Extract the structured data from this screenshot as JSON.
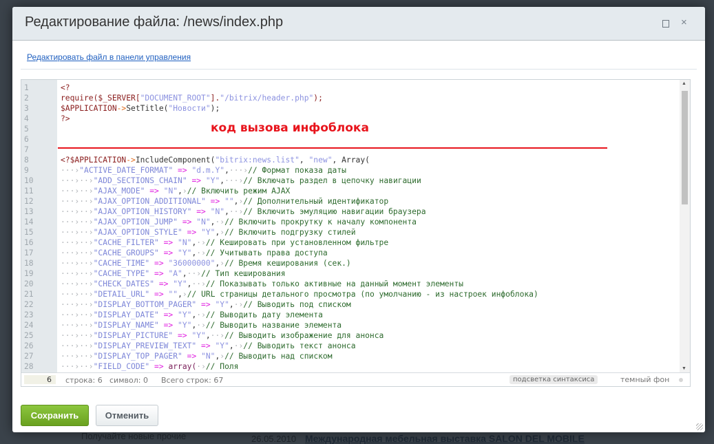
{
  "background": {
    "left_text": "Получайте новые прочие",
    "date": "26.05.2010",
    "news_link": "Международная мебельная выставка SALON DEL MOBILE"
  },
  "dialog": {
    "title": "Редактирование файла: /news/index.php",
    "maximize_icon": "square-icon",
    "close_label": "×",
    "edit_link": "Редактировать файл в панели управления"
  },
  "annotation": {
    "text": "код вызова инфоблока",
    "color": "#e8141c"
  },
  "code_lines": [
    [
      [
        "<?",
        "php"
      ]
    ],
    [
      [
        "require($_SERVER[",
        "php"
      ],
      [
        "\"DOCUMENT_ROOT\"",
        "s"
      ],
      [
        "].",
        "php"
      ],
      [
        "\"/bitrix/header.php\"",
        "s"
      ],
      [
        ");",
        "php"
      ]
    ],
    [
      [
        "$APPLICATION",
        "php"
      ],
      [
        "->",
        "ar"
      ],
      [
        "SetTitle(",
        "p"
      ],
      [
        "\"Новости\"",
        "s"
      ],
      [
        ");",
        "p"
      ]
    ],
    [
      [
        "?>",
        "php"
      ]
    ],
    [],
    [],
    [],
    [
      [
        "<?$APPLICATION",
        "php"
      ],
      [
        "->",
        "ar"
      ],
      [
        "IncludeComponent(",
        "p"
      ],
      [
        "\"bitrix:news.list\"",
        "s"
      ],
      [
        ", ",
        "p"
      ],
      [
        "\"new\"",
        "s"
      ],
      [
        ", Array(",
        "p"
      ]
    ],
    [
      [
        "···›",
        "w"
      ],
      [
        "\"ACTIVE_DATE_FORMAT\"",
        "k"
      ],
      [
        " => ",
        "o"
      ],
      [
        "\"d.m.Y\"",
        "s"
      ],
      [
        ",",
        "p"
      ],
      [
        "···›",
        "w"
      ],
      [
        "// Формат показа даты",
        "c"
      ]
    ],
    [
      [
        "···›··›",
        "w"
      ],
      [
        "\"ADD_SECTIONS_CHAIN\"",
        "k"
      ],
      [
        " => ",
        "o"
      ],
      [
        "\"Y\"",
        "s"
      ],
      [
        ",",
        "p"
      ],
      [
        "···›",
        "w"
      ],
      [
        "// Включать раздел в цепочку навигации",
        "c"
      ]
    ],
    [
      [
        "···›··›",
        "w"
      ],
      [
        "\"AJAX_MODE\"",
        "k"
      ],
      [
        " => ",
        "o"
      ],
      [
        "\"N\"",
        "s"
      ],
      [
        ",",
        "p"
      ],
      [
        "›",
        "w"
      ],
      [
        "// Включить режим AJAX",
        "c"
      ]
    ],
    [
      [
        "···›··›",
        "w"
      ],
      [
        "\"AJAX_OPTION_ADDITIONAL\"",
        "k"
      ],
      [
        " => ",
        "o"
      ],
      [
        "\"\"",
        "s"
      ],
      [
        ",",
        "p"
      ],
      [
        "›",
        "w"
      ],
      [
        "// Дополнительный идентификатор",
        "c"
      ]
    ],
    [
      [
        "···›··›",
        "w"
      ],
      [
        "\"AJAX_OPTION_HISTORY\"",
        "k"
      ],
      [
        " => ",
        "o"
      ],
      [
        "\"N\"",
        "s"
      ],
      [
        ",",
        "p"
      ],
      [
        "··›",
        "w"
      ],
      [
        "// Включить эмуляцию навигации браузера",
        "c"
      ]
    ],
    [
      [
        "···›··›",
        "w"
      ],
      [
        "\"AJAX_OPTION_JUMP\"",
        "k"
      ],
      [
        " => ",
        "o"
      ],
      [
        "\"N\"",
        "s"
      ],
      [
        ",",
        "p"
      ],
      [
        "·›",
        "w"
      ],
      [
        "// Включить прокрутку к началу компонента",
        "c"
      ]
    ],
    [
      [
        "···›··›",
        "w"
      ],
      [
        "\"AJAX_OPTION_STYLE\"",
        "k"
      ],
      [
        " => ",
        "o"
      ],
      [
        "\"Y\"",
        "s"
      ],
      [
        ",",
        "p"
      ],
      [
        "›",
        "w"
      ],
      [
        "// Включить подгрузку стилей",
        "c"
      ]
    ],
    [
      [
        "···›··›",
        "w"
      ],
      [
        "\"CACHE_FILTER\"",
        "k"
      ],
      [
        " => ",
        "o"
      ],
      [
        "\"N\"",
        "s"
      ],
      [
        ",",
        "p"
      ],
      [
        "·›",
        "w"
      ],
      [
        "// Кешировать при установленном фильтре",
        "c"
      ]
    ],
    [
      [
        "···›··›",
        "w"
      ],
      [
        "\"CACHE_GROUPS\"",
        "k"
      ],
      [
        " => ",
        "o"
      ],
      [
        "\"Y\"",
        "s"
      ],
      [
        ",",
        "p"
      ],
      [
        "·›",
        "w"
      ],
      [
        "// Учитывать права доступа",
        "c"
      ]
    ],
    [
      [
        "···›··›",
        "w"
      ],
      [
        "\"CACHE_TIME\"",
        "k"
      ],
      [
        " => ",
        "o"
      ],
      [
        "\"36000000\"",
        "s"
      ],
      [
        ",",
        "p"
      ],
      [
        "›",
        "w"
      ],
      [
        "// Время кеширования (сек.)",
        "c"
      ]
    ],
    [
      [
        "···›··›",
        "w"
      ],
      [
        "\"CACHE_TYPE\"",
        "k"
      ],
      [
        " => ",
        "o"
      ],
      [
        "\"A\"",
        "s"
      ],
      [
        ",",
        "p"
      ],
      [
        "··›",
        "w"
      ],
      [
        "// Тип кеширования",
        "c"
      ]
    ],
    [
      [
        "···›··›",
        "w"
      ],
      [
        "\"CHECK_DATES\"",
        "k"
      ],
      [
        " => ",
        "o"
      ],
      [
        "\"Y\"",
        "s"
      ],
      [
        ",",
        "p"
      ],
      [
        "··›",
        "w"
      ],
      [
        "// Показывать только активные на данный момент элементы",
        "c"
      ]
    ],
    [
      [
        "···›··›",
        "w"
      ],
      [
        "\"DETAIL_URL\"",
        "k"
      ],
      [
        " => ",
        "o"
      ],
      [
        "\"\"",
        "s"
      ],
      [
        ",",
        "p"
      ],
      [
        "›",
        "w"
      ],
      [
        "// URL страницы детального просмотра (по умолчанию - из настроек инфоблока)",
        "c"
      ]
    ],
    [
      [
        "···›··›",
        "w"
      ],
      [
        "\"DISPLAY_BOTTOM_PAGER\"",
        "k"
      ],
      [
        " => ",
        "o"
      ],
      [
        "\"Y\"",
        "s"
      ],
      [
        ",",
        "p"
      ],
      [
        "·›",
        "w"
      ],
      [
        "// Выводить под списком",
        "c"
      ]
    ],
    [
      [
        "···›··›",
        "w"
      ],
      [
        "\"DISPLAY_DATE\"",
        "k"
      ],
      [
        " => ",
        "o"
      ],
      [
        "\"Y\"",
        "s"
      ],
      [
        ",",
        "p"
      ],
      [
        "·›",
        "w"
      ],
      [
        "// Выводить дату элемента",
        "c"
      ]
    ],
    [
      [
        "···›··›",
        "w"
      ],
      [
        "\"DISPLAY_NAME\"",
        "k"
      ],
      [
        " => ",
        "o"
      ],
      [
        "\"Y\"",
        "s"
      ],
      [
        ",",
        "p"
      ],
      [
        "·›",
        "w"
      ],
      [
        "// Выводить название элемента",
        "c"
      ]
    ],
    [
      [
        "···›··›",
        "w"
      ],
      [
        "\"DISPLAY_PICTURE\"",
        "k"
      ],
      [
        " => ",
        "o"
      ],
      [
        "\"Y\"",
        "s"
      ],
      [
        ",",
        "p"
      ],
      [
        "··›",
        "w"
      ],
      [
        "// Выводить изображение для анонса",
        "c"
      ]
    ],
    [
      [
        "···›··›",
        "w"
      ],
      [
        "\"DISPLAY_PREVIEW_TEXT\"",
        "k"
      ],
      [
        " => ",
        "o"
      ],
      [
        "\"Y\"",
        "s"
      ],
      [
        ",",
        "p"
      ],
      [
        "·›",
        "w"
      ],
      [
        "// Выводить текст анонса",
        "c"
      ]
    ],
    [
      [
        "···›··›",
        "w"
      ],
      [
        "\"DISPLAY_TOP_PAGER\"",
        "k"
      ],
      [
        " => ",
        "o"
      ],
      [
        "\"N\"",
        "s"
      ],
      [
        ",",
        "p"
      ],
      [
        "›",
        "w"
      ],
      [
        "// Выводить над списком",
        "c"
      ]
    ],
    [
      [
        "···›··›",
        "w"
      ],
      [
        "\"FIELD_CODE\"",
        "k"
      ],
      [
        " => ",
        "o"
      ],
      [
        "array(",
        "f"
      ],
      [
        "·›",
        "w"
      ],
      [
        "// Поля",
        "c"
      ]
    ]
  ],
  "status": {
    "current_line": "6",
    "row": "строка: 6",
    "col": "символ: 0",
    "total": "Всего строк: 67",
    "highlight": "подсветка синтаксиса",
    "dark": "темный фон"
  },
  "buttons": {
    "save": "Сохранить",
    "cancel": "Отменить"
  }
}
